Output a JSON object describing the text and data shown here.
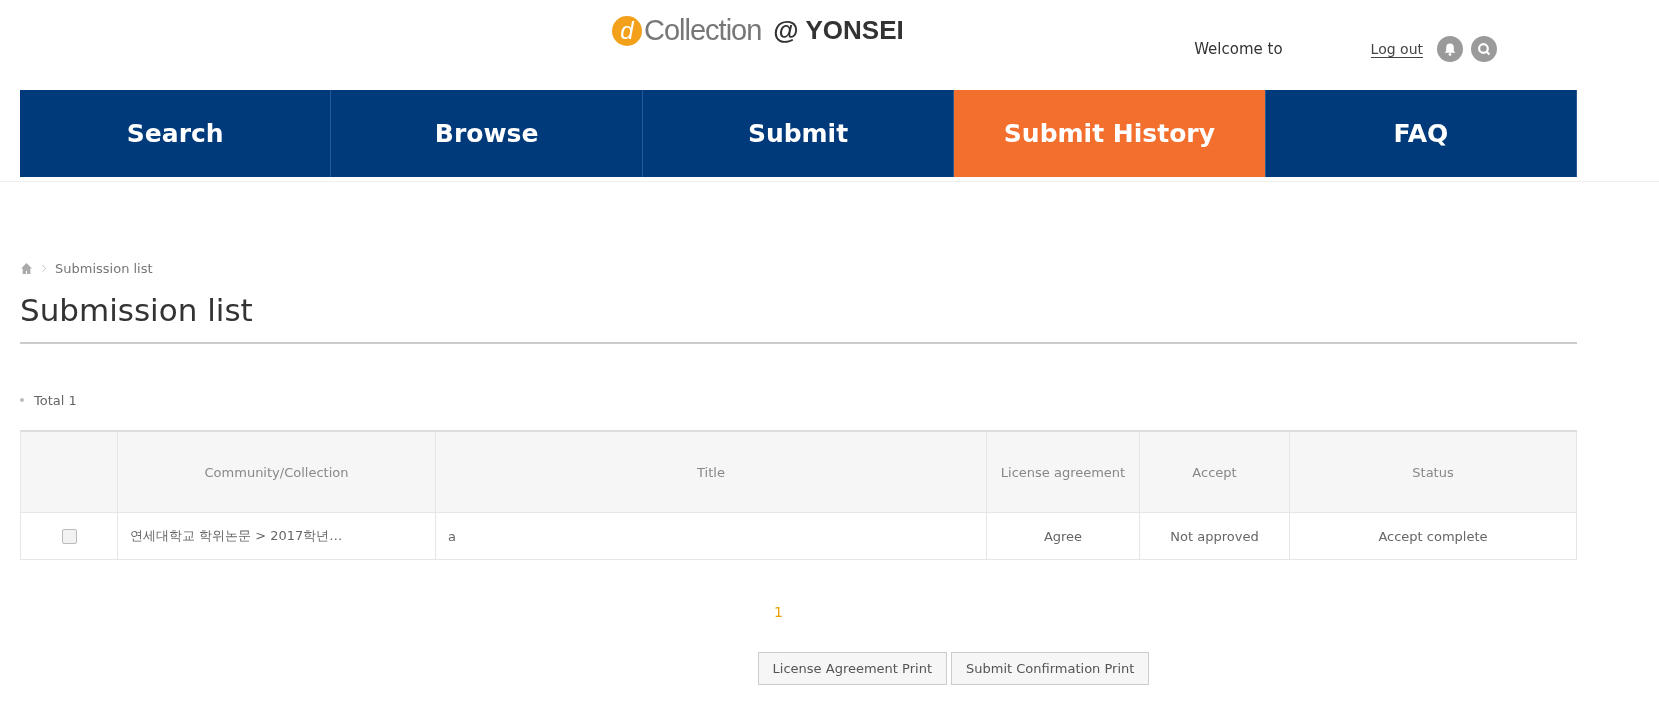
{
  "logo": {
    "mark": "d",
    "name": "Collection",
    "suffix": "@ YONSEI"
  },
  "user_bar": {
    "welcome": "Welcome to",
    "logout": "Log out"
  },
  "tabs": [
    {
      "label": "Search",
      "selected": false
    },
    {
      "label": "Browse",
      "selected": false
    },
    {
      "label": "Submit",
      "selected": false
    },
    {
      "label": "Submit History",
      "selected": true
    },
    {
      "label": "FAQ",
      "selected": false
    }
  ],
  "breadcrumb": [
    "Submission list"
  ],
  "heading": "Submission list",
  "total": "Total 1",
  "table": {
    "columns": [
      "Community/Collection",
      "Title",
      "License agreement",
      "Accept",
      "Status"
    ],
    "rows": [
      {
        "checked": false,
        "cells": [
          "연세대학교 학위논문 > 2017학년…",
          "a",
          "Agree",
          "Not approved",
          "Accept complete"
        ]
      }
    ]
  },
  "pagination": [
    {
      "label": "1",
      "selected": true
    }
  ],
  "buttons": [
    "License Agreement Print",
    "Submit Confirmation Print"
  ]
}
